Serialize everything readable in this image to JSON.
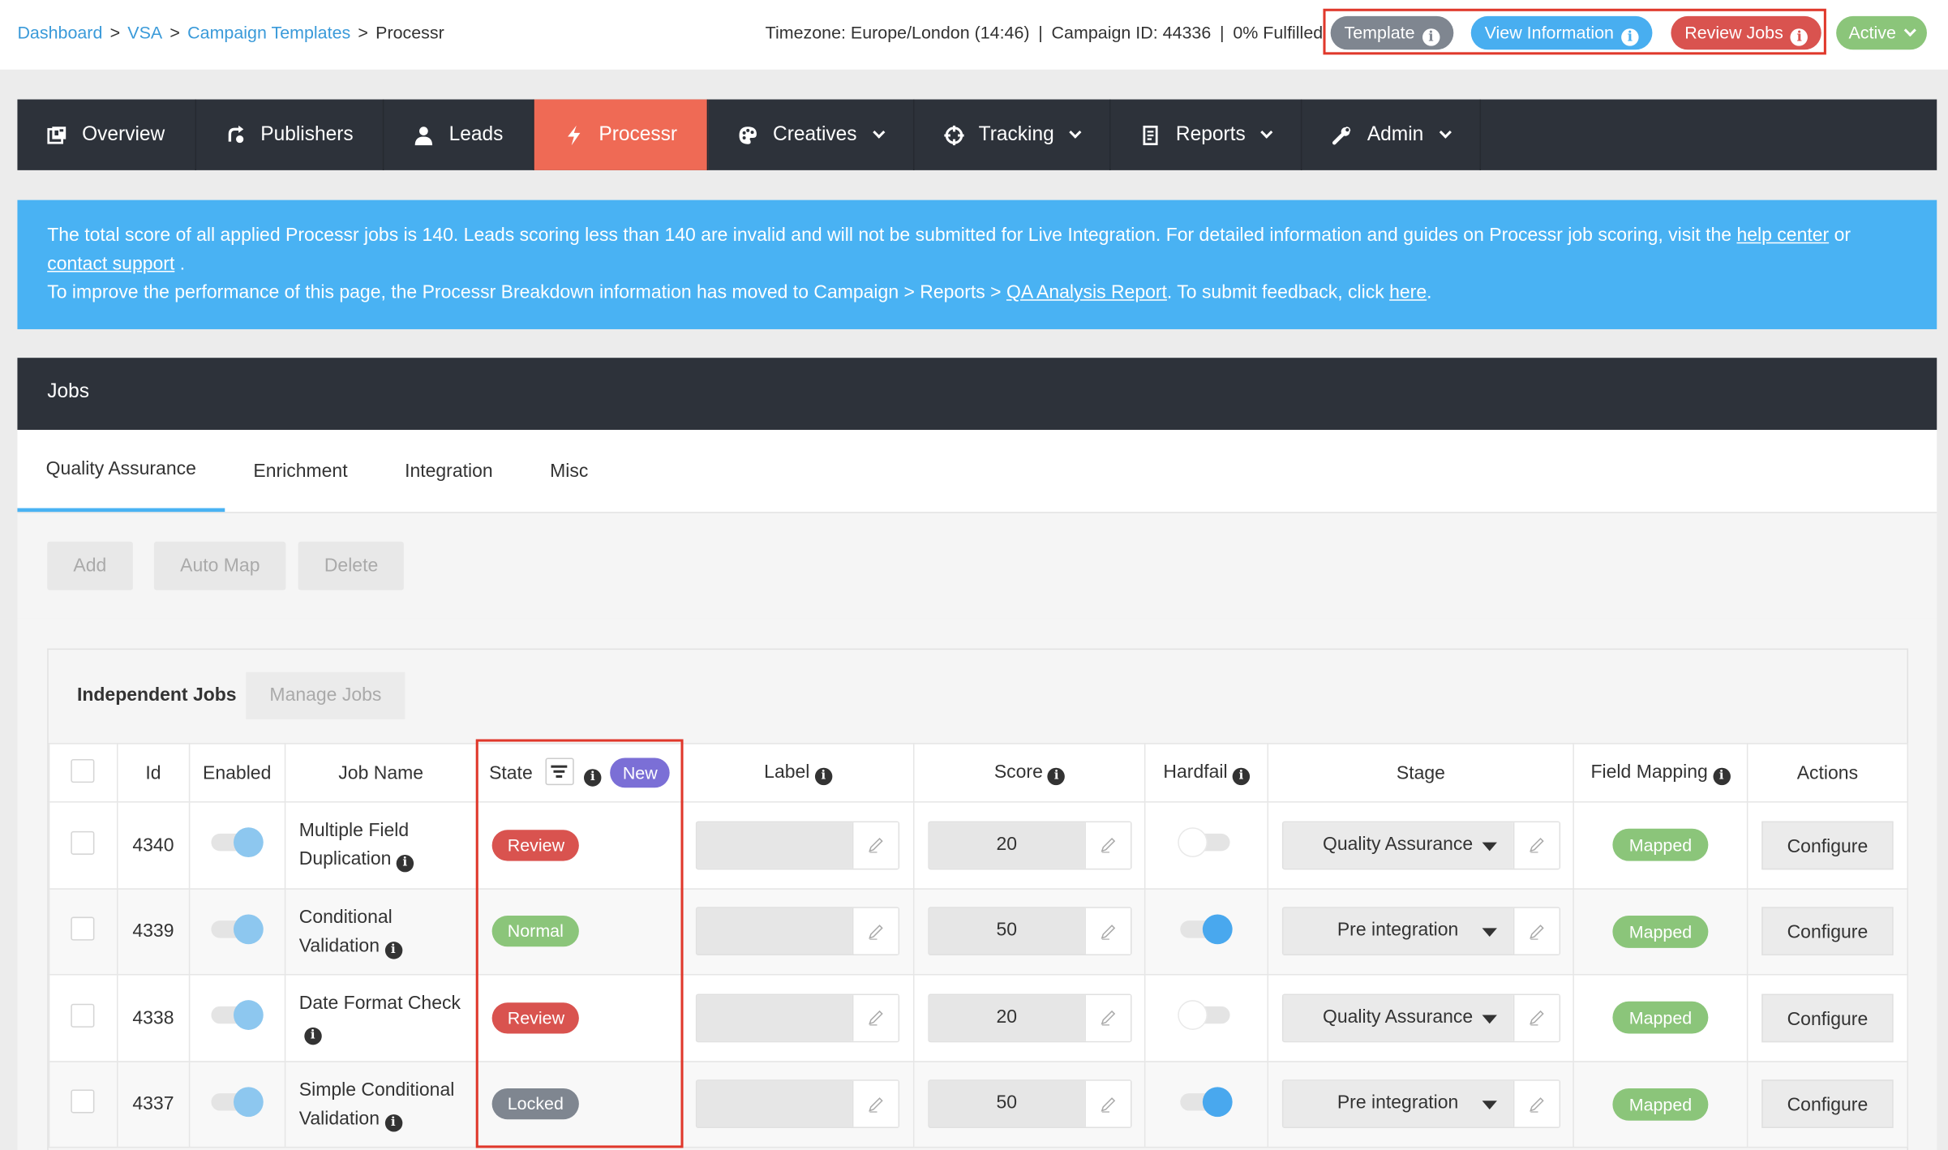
{
  "breadcrumb": {
    "items": [
      "Dashboard",
      "VSA",
      "Campaign Templates"
    ],
    "current": "Processr",
    "separator": ">"
  },
  "meta": {
    "timezone": "Timezone: Europe/London (14:46)",
    "campaign": "Campaign ID: 44336",
    "fulfilled": "0% Fulfilled",
    "separator": "|"
  },
  "header_buttons": {
    "template": "Template",
    "view_information": "View Information",
    "review_jobs": "Review Jobs",
    "status": "Active",
    "info_glyph": "i"
  },
  "nav": {
    "items": [
      {
        "label": "Overview",
        "icon": "overview-icon"
      },
      {
        "label": "Publishers",
        "icon": "publishers-icon"
      },
      {
        "label": "Leads",
        "icon": "user-icon"
      },
      {
        "label": "Processr",
        "icon": "bolt-icon"
      },
      {
        "label": "Creatives",
        "icon": "palette-icon"
      },
      {
        "label": "Tracking",
        "icon": "crosshair-icon"
      },
      {
        "label": "Reports",
        "icon": "report-icon"
      },
      {
        "label": "Admin",
        "icon": "wrench-icon"
      }
    ]
  },
  "banner": {
    "line1_prefix": "The total score of all applied Processr jobs is 140. Leads scoring less than 140 are invalid and will not be submitted for Live Integration. For detailed information and guides on Processr job scoring, visit the",
    "help_link": "help center",
    "or": "or",
    "contact_link": "contact support",
    "period": ".",
    "line2_prefix": "To improve the performance of this page, the Processr Breakdown information has moved to Campaign > Reports >",
    "qa_link": "QA Analysis Report",
    "line2_mid": ". To submit feedback, click",
    "here_link": "here",
    "line2_end": "."
  },
  "jobs_panel": {
    "title": "Jobs",
    "tabs": [
      "Quality Assurance",
      "Enrichment",
      "Integration",
      "Misc"
    ],
    "actions": {
      "add": "Add",
      "auto_map": "Auto Map",
      "delete": "Delete"
    },
    "section_title": "Independent Jobs",
    "manage_jobs": "Manage Jobs"
  },
  "table": {
    "headers": {
      "id": "Id",
      "enabled": "Enabled",
      "job_name": "Job Name",
      "state": "State",
      "state_badge": "New",
      "label": "Label",
      "score": "Score",
      "hardfail": "Hardfail",
      "stage": "Stage",
      "field_mapping": "Field Mapping",
      "actions": "Actions"
    },
    "rows": [
      {
        "id": "4340",
        "enabled": true,
        "name_line1": "Multiple Field",
        "name_line2": "Duplication",
        "state": "Review",
        "label": "",
        "score": "20",
        "hardfail": false,
        "stage": "Quality Assurance",
        "mapping": "Mapped",
        "action": "Configure"
      },
      {
        "id": "4339",
        "enabled": true,
        "name_line1": "Conditional",
        "name_line2": "Validation",
        "state": "Normal",
        "label": "",
        "score": "50",
        "hardfail": true,
        "stage": "Pre integration",
        "mapping": "Mapped",
        "action": "Configure"
      },
      {
        "id": "4338",
        "enabled": true,
        "name_line1": "Date Format Check",
        "name_line2": "",
        "state": "Review",
        "label": "",
        "score": "20",
        "hardfail": false,
        "stage": "Quality Assurance",
        "mapping": "Mapped",
        "action": "Configure"
      },
      {
        "id": "4337",
        "enabled": true,
        "name_line1": "Simple Conditional",
        "name_line2": "Validation",
        "state": "Locked",
        "label": "",
        "score": "50",
        "hardfail": true,
        "stage": "Pre integration",
        "mapping": "Mapped",
        "action": "Configure"
      }
    ]
  },
  "colors": {
    "accent_blue": "#49b2f3",
    "nav_dark": "#2d323a",
    "nav_active": "#ef6a55",
    "review_red": "#d9534f",
    "normal_green": "#8bc57a",
    "locked_gray": "#7f8690",
    "new_purple": "#7b6fd6",
    "highlight_red": "#e0382b"
  }
}
